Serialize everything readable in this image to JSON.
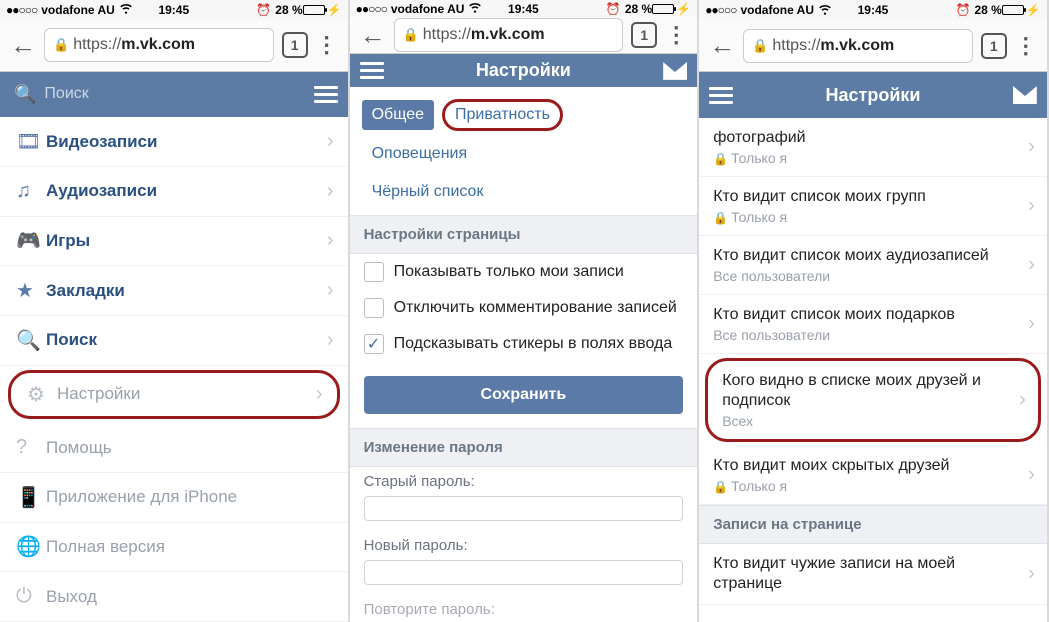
{
  "statusbar": {
    "signal": "●●○○○",
    "carrier": "vodafone AU",
    "time": "19:45",
    "battery_pct": "28 %",
    "alarm": "⏰"
  },
  "browser": {
    "url_prefix": "https://",
    "url_host": "m.vk.com",
    "tab_count": "1"
  },
  "panel1": {
    "search_placeholder": "Поиск",
    "menu": [
      {
        "icon": "video",
        "label": "Видеозаписи"
      },
      {
        "icon": "audio",
        "label": "Аудиозаписи"
      },
      {
        "icon": "games",
        "label": "Игры"
      },
      {
        "icon": "bookmark",
        "label": "Закладки"
      },
      {
        "icon": "search",
        "label": "Поиск"
      },
      {
        "icon": "gear",
        "label": "Настройки"
      },
      {
        "icon": "help",
        "label": "Помощь"
      },
      {
        "icon": "phone",
        "label": "Приложение для iPhone"
      },
      {
        "icon": "globe",
        "label": "Полная версия"
      },
      {
        "icon": "power",
        "label": "Выход"
      }
    ]
  },
  "panel2": {
    "header_title": "Настройки",
    "tabs": {
      "general": "Общее",
      "privacy": "Приватность",
      "notify": "Оповещения",
      "blacklist": "Чёрный список"
    },
    "section_page": "Настройки страницы",
    "checks": [
      {
        "label": "Показывать только мои записи",
        "checked": false
      },
      {
        "label": "Отключить комментирование записей",
        "checked": false
      },
      {
        "label": "Подсказывать стикеры в полях ввода",
        "checked": true
      }
    ],
    "save": "Сохранить",
    "section_pwd": "Изменение пароля",
    "old_pwd": "Старый пароль:",
    "new_pwd": "Новый пароль:",
    "repeat_pwd": "Повторите пароль:"
  },
  "panel3": {
    "header_title": "Настройки",
    "rows": [
      {
        "title_tail": "фотографий",
        "sub": "Только я",
        "locked": true
      },
      {
        "title": "Кто видит список моих групп",
        "sub": "Только я",
        "locked": true
      },
      {
        "title": "Кто видит список моих аудиозаписей",
        "sub": "Все пользователи",
        "locked": false
      },
      {
        "title": "Кто видит список моих подарков",
        "sub": "Все пользователи",
        "locked": false
      },
      {
        "title": "Кого видно в списке моих друзей и подписок",
        "sub": "Всех",
        "locked": false
      },
      {
        "title": "Кто видит моих скрытых друзей",
        "sub": "Только я",
        "locked": true
      }
    ],
    "section_wall": "Записи на странице",
    "wall_row": {
      "title": "Кто видит чужие записи на моей странице"
    }
  }
}
